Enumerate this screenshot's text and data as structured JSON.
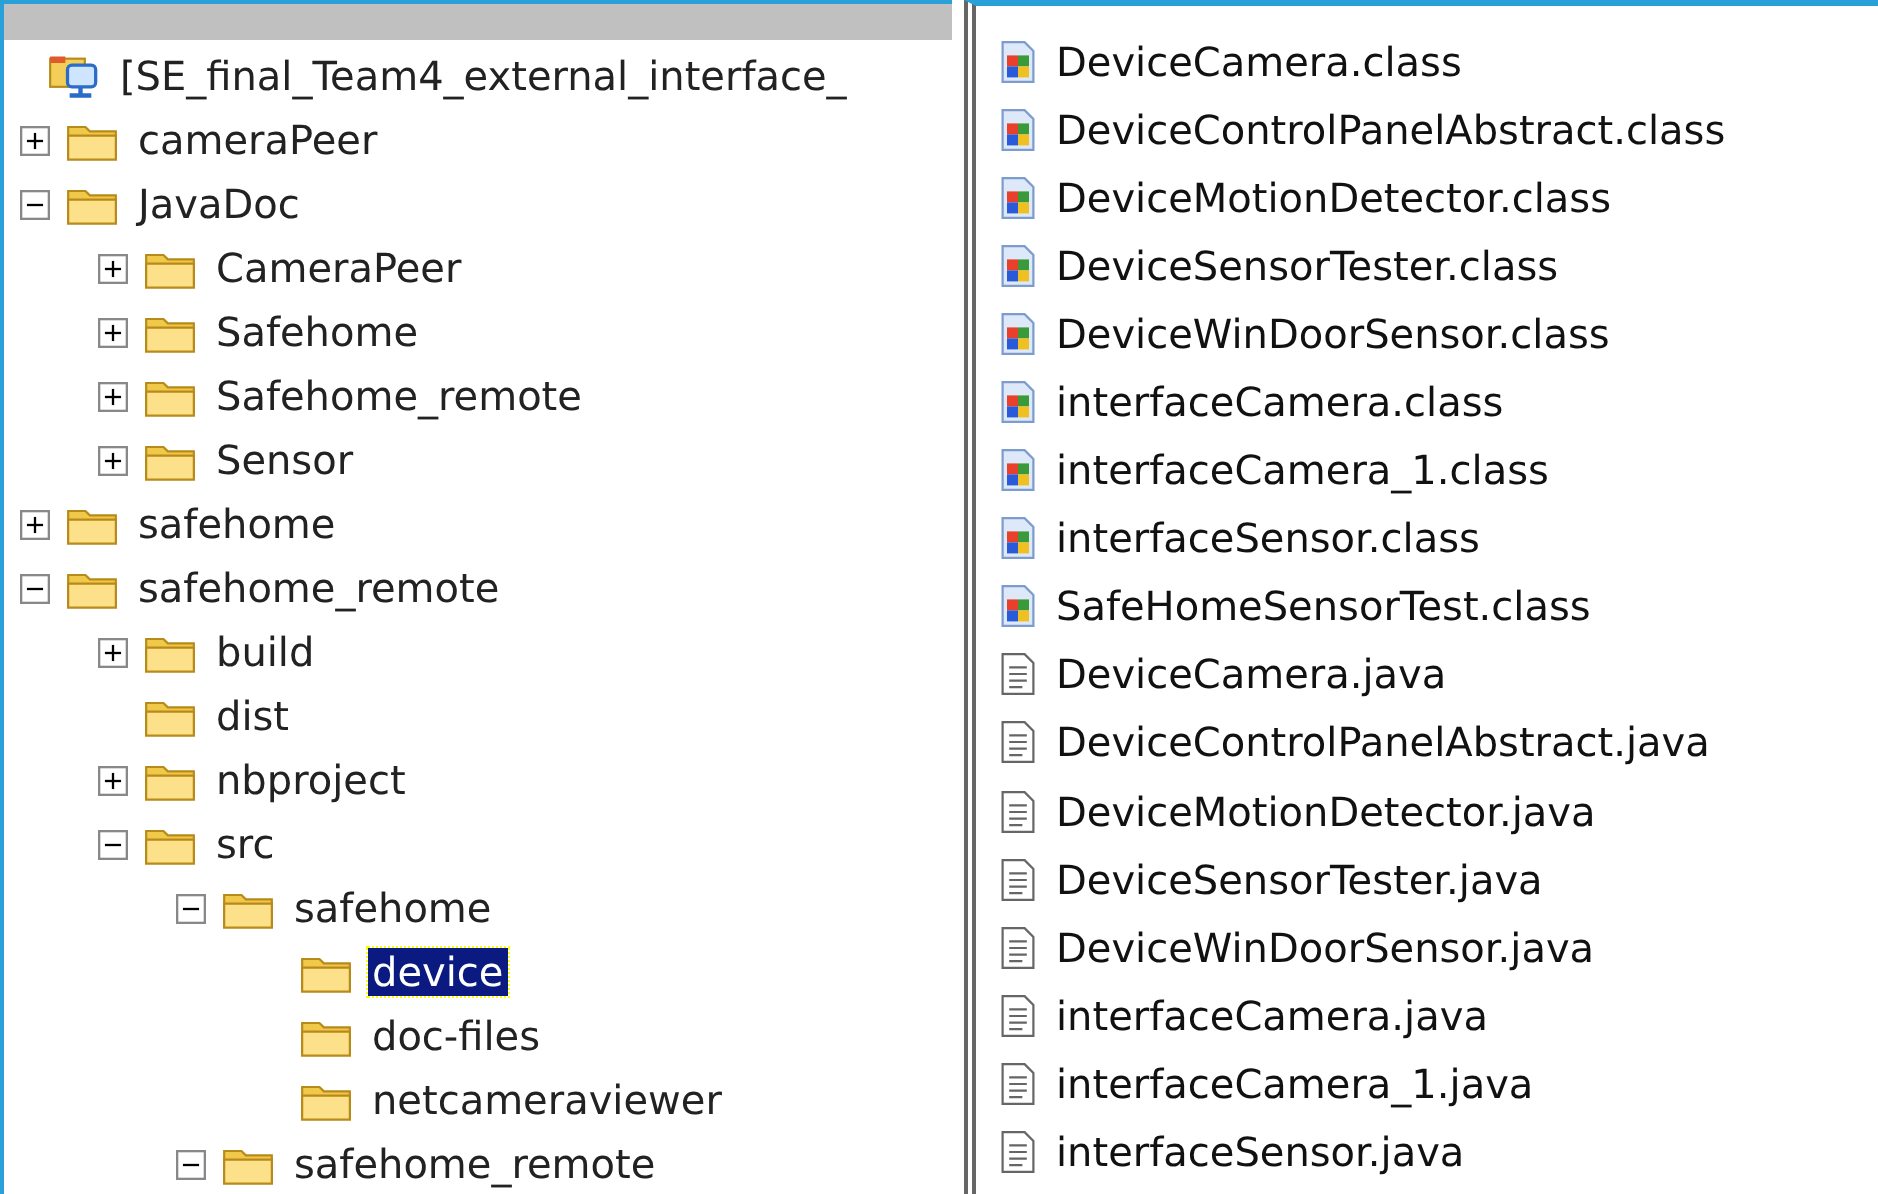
{
  "folder_tree": {
    "root": {
      "label": "[SE_final_Team4_external_interface_"
    },
    "items": [
      {
        "label": "cameraPeer",
        "expanded": false
      },
      {
        "label": "JavaDoc",
        "expanded": true,
        "children": [
          {
            "label": "CameraPeer",
            "expanded": false
          },
          {
            "label": "Safehome",
            "expanded": false
          },
          {
            "label": "Safehome_remote",
            "expanded": false
          },
          {
            "label": "Sensor",
            "expanded": false
          }
        ]
      },
      {
        "label": "safehome",
        "expanded": false
      },
      {
        "label": "safehome_remote",
        "expanded": true,
        "children": [
          {
            "label": "build",
            "expanded": false
          },
          {
            "label": "dist"
          },
          {
            "label": "nbproject",
            "expanded": false
          },
          {
            "label": "src",
            "expanded": true,
            "children": [
              {
                "label": "safehome",
                "expanded": true,
                "children": [
                  {
                    "label": "device",
                    "selected": true
                  },
                  {
                    "label": "doc-files",
                    "selected": false
                  },
                  {
                    "label": "netcameraviewer",
                    "selected": false
                  }
                ]
              },
              {
                "label": "safehome_remote",
                "expanded": true
              }
            ]
          }
        ]
      }
    ]
  },
  "file_list": [
    {
      "name": "DeviceCamera.class",
      "kind": "class"
    },
    {
      "name": "DeviceControlPanelAbstract.class",
      "kind": "class"
    },
    {
      "name": "DeviceMotionDetector.class",
      "kind": "class"
    },
    {
      "name": "DeviceSensorTester.class",
      "kind": "class"
    },
    {
      "name": "DeviceWinDoorSensor.class",
      "kind": "class"
    },
    {
      "name": "interfaceCamera.class",
      "kind": "class"
    },
    {
      "name": "interfaceCamera_1.class",
      "kind": "class"
    },
    {
      "name": "interfaceSensor.class",
      "kind": "class"
    },
    {
      "name": "SafeHomeSensorTest.class",
      "kind": "class"
    },
    {
      "name": "DeviceCamera.java",
      "kind": "java"
    },
    {
      "name": "DeviceControlPanelAbstract.java",
      "kind": "java"
    },
    {
      "name": "DeviceMotionDetector.java",
      "kind": "java"
    },
    {
      "name": "DeviceSensorTester.java",
      "kind": "java"
    },
    {
      "name": "DeviceWinDoorSensor.java",
      "kind": "java"
    },
    {
      "name": "interfaceCamera.java",
      "kind": "java"
    },
    {
      "name": "interfaceCamera_1.java",
      "kind": "java"
    },
    {
      "name": "interfaceSensor.java",
      "kind": "java"
    }
  ]
}
